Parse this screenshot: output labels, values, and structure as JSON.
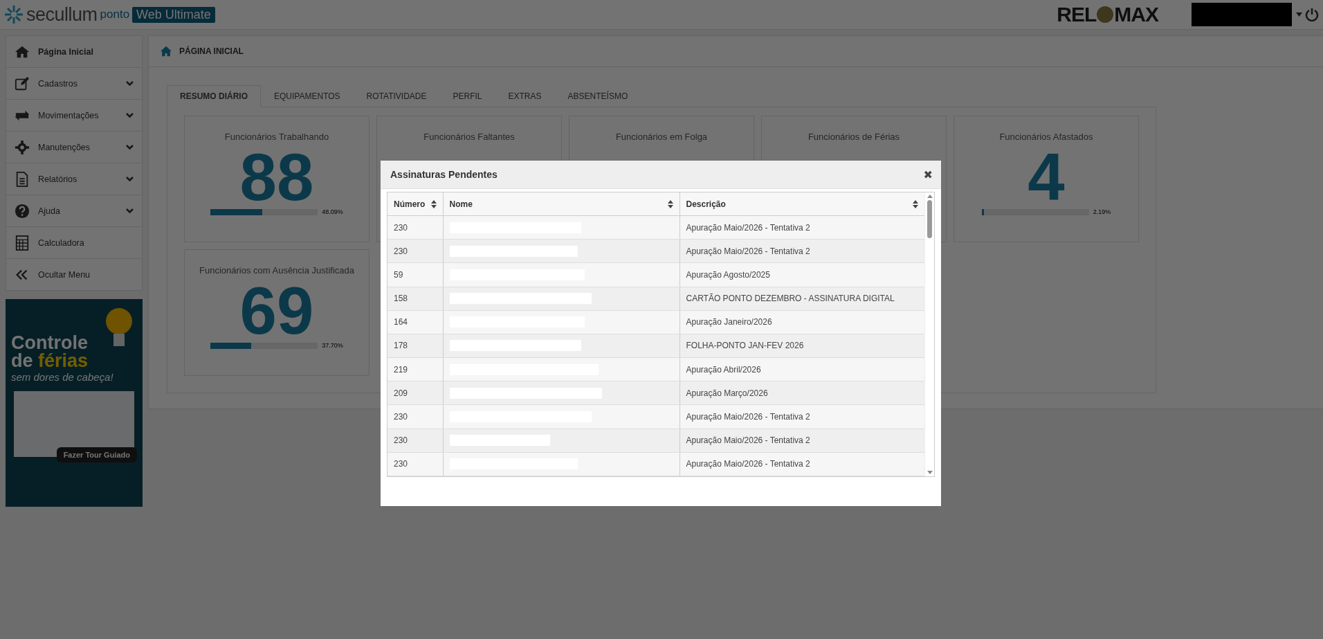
{
  "header": {
    "brand": "secullum",
    "product": "ponto",
    "edition": "Web Ultimate",
    "partner_logo": [
      "REL",
      "MAX"
    ]
  },
  "sidebar": {
    "items": [
      {
        "label": "Página Inicial",
        "kind": "home",
        "selected": true,
        "expandable": false
      },
      {
        "label": "Cadastros",
        "kind": "edit",
        "selected": false,
        "expandable": true
      },
      {
        "label": "Movimentações",
        "kind": "swap",
        "selected": false,
        "expandable": true
      },
      {
        "label": "Manutenções",
        "kind": "gear",
        "selected": false,
        "expandable": true
      },
      {
        "label": "Relatórios",
        "kind": "doc",
        "selected": false,
        "expandable": true
      },
      {
        "label": "Ajuda",
        "kind": "help",
        "selected": false,
        "expandable": true
      },
      {
        "label": "Calculadora",
        "kind": "calc",
        "selected": false,
        "expandable": false
      },
      {
        "label": "Ocultar Menu",
        "kind": "chevrons",
        "selected": false,
        "expandable": false
      }
    ],
    "promo": {
      "title_line1": "Controle",
      "title_line2_prefix": "de",
      "title_line2_highlight": "férias",
      "subtitle": "sem dores de cabeça!",
      "button": "Fazer Tour Guiado"
    }
  },
  "main": {
    "breadcrumb": "PÁGINA INICIAL",
    "tabs": [
      {
        "label": "RESUMO DIÁRIO",
        "selected": true
      },
      {
        "label": "EQUIPAMENTOS",
        "selected": false
      },
      {
        "label": "ROTATIVIDADE",
        "selected": false
      },
      {
        "label": "PERFIL",
        "selected": false
      },
      {
        "label": "EXTRAS",
        "selected": false
      },
      {
        "label": "ABSENTEÍSMO",
        "selected": false
      }
    ],
    "cards": [
      {
        "title": "Funcionários Trabalhando",
        "value": "88",
        "level": 0.4809,
        "percent": "48.09%"
      },
      {
        "title": "Funcionários Faltantes"
      },
      {
        "title": "Funcionários em Folga"
      },
      {
        "title": "Funcionários de Férias"
      },
      {
        "title": "Funcionários Afastados",
        "value": "4",
        "level": 0.0219,
        "percent": "2.19%"
      },
      {
        "title": "Funcionários com Ausência Justificada",
        "value": "69",
        "level": 0.377,
        "percent": "37.70%"
      }
    ]
  },
  "modal": {
    "title": "Assinaturas Pendentes",
    "close": "✖",
    "columns": [
      "Número",
      "Nome",
      "Descrição"
    ],
    "rows": [
      {
        "number": "230",
        "description": "Apuração Maio/2026 - Tentativa 2"
      },
      {
        "number": "230",
        "description": "Apuração Maio/2026 - Tentativa 2"
      },
      {
        "number": "59",
        "description": "Apuração Agosto/2025"
      },
      {
        "number": "158",
        "description": "CARTÃO PONTO DEZEMBRO - ASSINATURA DIGITAL"
      },
      {
        "number": "164",
        "description": "Apuração Janeiro/2026"
      },
      {
        "number": "178",
        "description": "FOLHA-PONTO JAN-FEV 2026"
      },
      {
        "number": "219",
        "description": "Apuração Abril/2026"
      },
      {
        "number": "209",
        "description": "Apuração Março/2026"
      },
      {
        "number": "230",
        "description": "Apuração Maio/2026 - Tentativa 2"
      },
      {
        "number": "230",
        "description": "Apuração Maio/2026 - Tentativa 2"
      },
      {
        "number": "230",
        "description": "Apuração Maio/2026 - Tentativa 2"
      }
    ]
  }
}
